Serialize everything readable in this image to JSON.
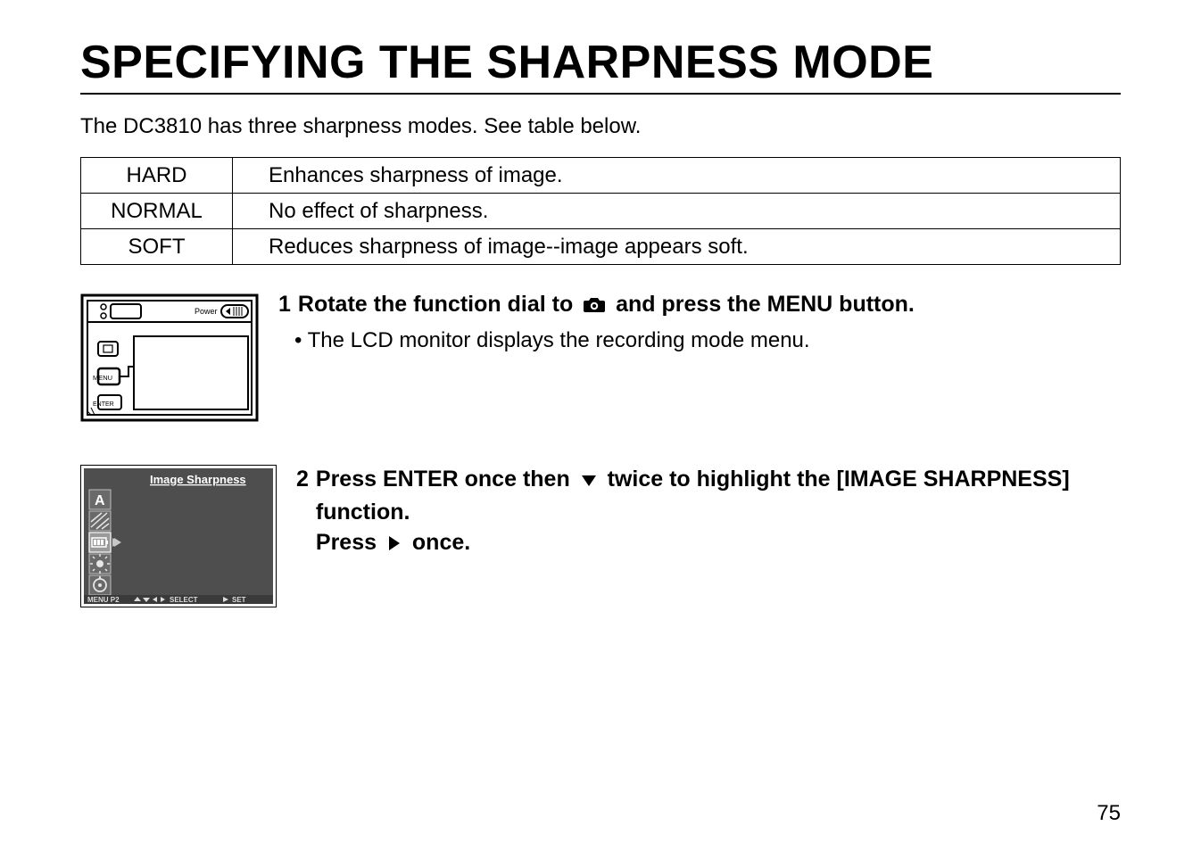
{
  "title": "SPECIFYING THE SHARPNESS MODE",
  "intro": "The DC3810 has three sharpness modes. See table below.",
  "modes": [
    {
      "label": "HARD",
      "desc": "Enhances sharpness of image."
    },
    {
      "label": "NORMAL",
      "desc": "No effect of sharpness."
    },
    {
      "label": "SOFT",
      "desc": "Reduces sharpness of image--image appears soft."
    }
  ],
  "step1": {
    "num": "1",
    "text_a": "Rotate the function dial to ",
    "icon_name": "camera-icon",
    "text_b": " and press the MENU button.",
    "bullet": "• The LCD monitor displays the recording mode menu."
  },
  "illus1": {
    "power_label": "Power",
    "menu_label": "MENU",
    "enter_label": "ENTER",
    "lcd_label": ""
  },
  "step2": {
    "num": "2",
    "text_a": "Press ENTER once then ",
    "icon1_name": "down-triangle-icon",
    "text_b": " twice to highlight the [IMAGE SHARPNESS] function.",
    "text_c": "Press ",
    "icon2_name": "right-triangle-icon",
    "text_d": " once."
  },
  "illus2": {
    "title": "Image Sharpness",
    "footer_left": "MENU P2",
    "footer_mid": "SELECT",
    "footer_right": "SET",
    "icons": {
      "a": "A",
      "sharp": "sharpness-icon",
      "battery": "battery-icon",
      "brightness": "brightness-icon",
      "selftimer": "self-timer-icon"
    }
  },
  "page_number": "75"
}
